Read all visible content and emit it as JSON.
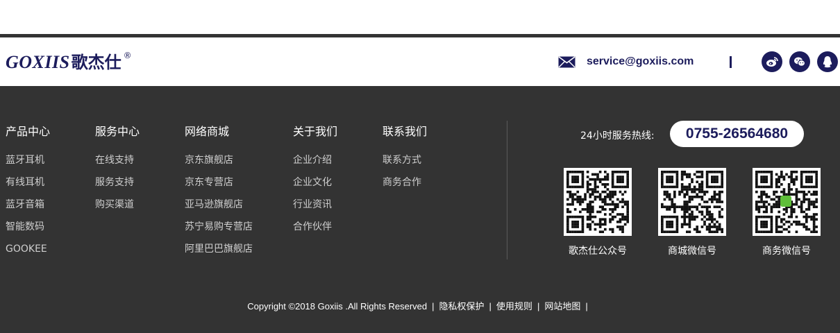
{
  "header": {
    "logo_latin": "GOXIIS",
    "logo_cn": "歌杰仕",
    "logo_reg": "®",
    "email": "service@goxiis.com",
    "social_icons": [
      "weibo-icon",
      "wechat-icon",
      "qq-icon"
    ]
  },
  "footer": {
    "columns": [
      {
        "title": "产品中心",
        "items": [
          "蓝牙耳机",
          "有线耳机",
          "蓝牙音箱",
          "智能数码",
          "GOOKEE"
        ]
      },
      {
        "title": "服务中心",
        "items": [
          "在线支持",
          "服务支持",
          "购买渠道"
        ]
      },
      {
        "title": "网络商城",
        "items": [
          "京东旗舰店",
          "京东专营店",
          "亚马逊旗舰店",
          "苏宁易购专营店",
          "阿里巴巴旗舰店"
        ]
      },
      {
        "title": "关于我们",
        "items": [
          "企业介绍",
          "企业文化",
          "行业资讯",
          "合作伙伴"
        ]
      },
      {
        "title": "联系我们",
        "items": [
          "联系方式",
          "商务合作"
        ]
      }
    ],
    "hotline_label": "24小时服务热线:",
    "hotline_number": "0755-26564680",
    "qr_codes": [
      {
        "caption": "歌杰仕公众号"
      },
      {
        "caption": "商城微信号"
      },
      {
        "caption": "商务微信号"
      }
    ],
    "copyright": "Copyright ©2018 Goxiis .All Rights Reserved",
    "links": [
      "隐私权保护",
      "使用规则",
      "网站地图"
    ],
    "separator": "|"
  },
  "colors": {
    "brand_navy": "#1c1c5c",
    "footer_bg": "#333333",
    "rule": "#333333"
  }
}
